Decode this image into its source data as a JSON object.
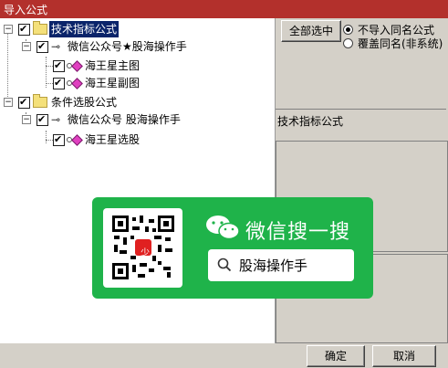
{
  "window": {
    "title": "导入公式"
  },
  "tree": {
    "groups": [
      {
        "label": "技术指标公式",
        "selected": true,
        "owner": "微信公众号★股海操作手",
        "items": [
          "海王星主图",
          "海王星副图"
        ]
      },
      {
        "label": "条件选股公式",
        "selected": false,
        "owner": "微信公众号 股海操作手",
        "items": [
          "海王星选股"
        ]
      }
    ]
  },
  "options": {
    "select_all_label": "全部选中",
    "radio_skip_label": "不导入同名公式",
    "radio_overwrite_label": "覆盖同名(非系统)",
    "selected": "skip"
  },
  "detail": {
    "section_title": "技术指标公式"
  },
  "promo": {
    "title": "微信搜一搜",
    "search_text": "股海操作手",
    "qr_badge": "少"
  },
  "footer": {
    "ok_label": "确定",
    "cancel_label": "取消"
  }
}
